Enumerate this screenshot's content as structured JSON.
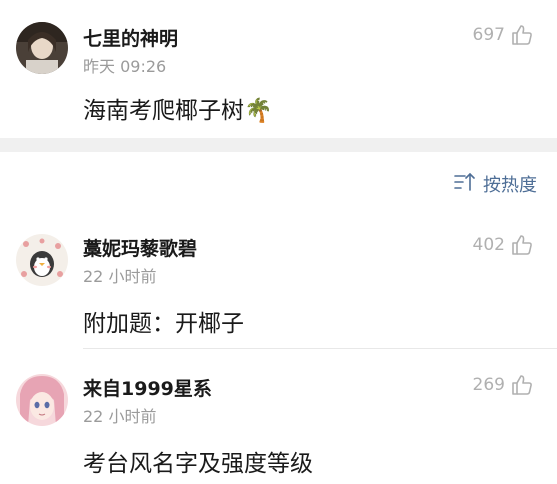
{
  "comments": [
    {
      "username": "七里的神明",
      "time": "昨天 09:26",
      "text": "海南考爬椰子树",
      "emoji": "🌴",
      "likes": "697"
    }
  ],
  "sort": {
    "label": "按热度"
  },
  "replies": [
    {
      "username": "藁妮玛藜歌碧",
      "time": "22 小时前",
      "text": "附加题：开椰子",
      "likes": "402"
    },
    {
      "username": "来自1999星系",
      "time": "22 小时前",
      "text": "考台风名字及强度等级",
      "likes": "269"
    }
  ],
  "colors": {
    "link": "#4e6e96",
    "muted": "#9b9b9b",
    "separator": "#f0f0f0"
  }
}
